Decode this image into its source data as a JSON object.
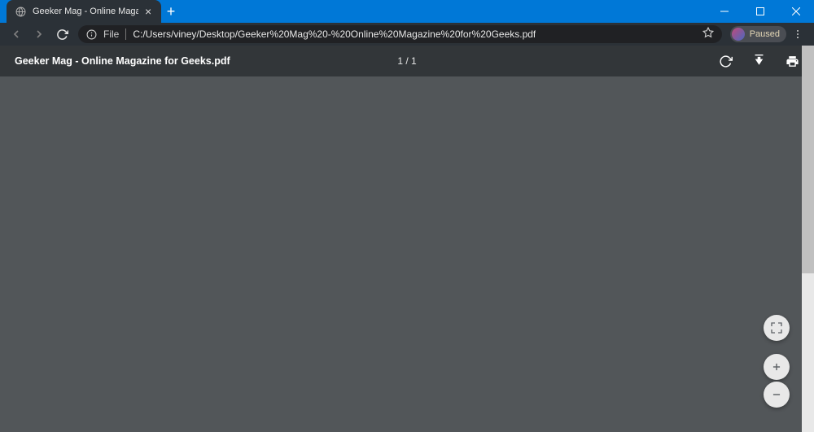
{
  "window": {
    "tab_title": "Geeker Mag - Online Magazine f"
  },
  "addressbar": {
    "scheme": "File",
    "url": "C:/Users/viney/Desktop/Geeker%20Mag%20-%20Online%20Magazine%20for%20Geeks.pdf"
  },
  "profile": {
    "status": "Paused"
  },
  "pdf": {
    "filename": "Geeker Mag - Online Magazine for Geeks.pdf",
    "page_indicator": "1 / 1"
  }
}
